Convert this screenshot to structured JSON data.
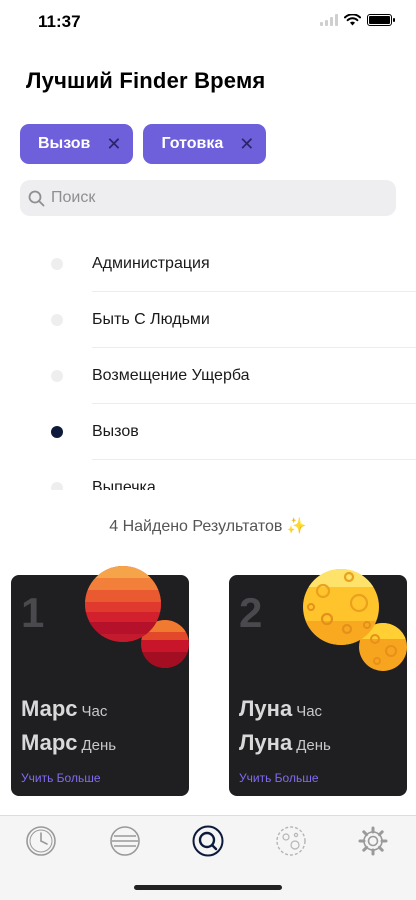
{
  "status": {
    "time": "11:37"
  },
  "title": "Лучший Finder Время",
  "filters": [
    {
      "label": "Вызов"
    },
    {
      "label": "Готовка"
    }
  ],
  "search": {
    "placeholder": "Поиск"
  },
  "list": [
    {
      "label": "Администрация",
      "selected": false
    },
    {
      "label": "Быть С Людьми",
      "selected": false
    },
    {
      "label": "Возмещение Ущерба",
      "selected": false
    },
    {
      "label": "Вызов",
      "selected": true
    },
    {
      "label": "Выпечка",
      "selected": false
    }
  ],
  "results": {
    "text": "4 Найдено Результатов ✨"
  },
  "cards": [
    {
      "number": "1",
      "planet": "Марс",
      "hour_label": "Час",
      "day_label": "День",
      "link": "Учить Больше"
    },
    {
      "number": "2",
      "planet": "Луна",
      "hour_label": "Час",
      "day_label": "День",
      "link": "Учить Больше"
    }
  ],
  "tabbar": {
    "items": [
      {
        "icon": "clock-icon",
        "active": false
      },
      {
        "icon": "planet-icon",
        "active": false
      },
      {
        "icon": "search-icon",
        "active": true
      },
      {
        "icon": "moon-icon",
        "active": false
      },
      {
        "icon": "gear-icon",
        "active": false
      }
    ]
  },
  "colors": {
    "accent": "#6E5FDB",
    "card_bg": "#1F1F22",
    "link": "#7F6CF0",
    "selected_dot": "#0E1A3B"
  }
}
